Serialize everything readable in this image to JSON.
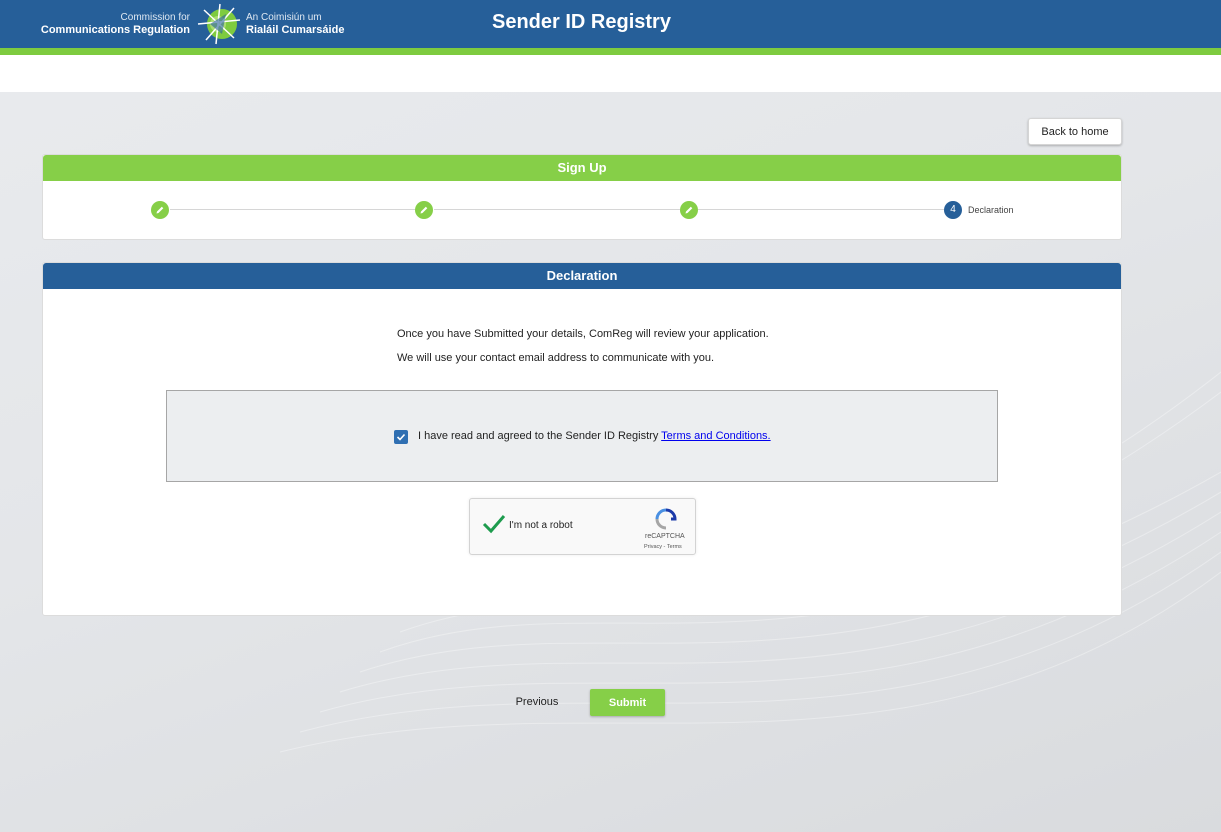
{
  "header": {
    "logo_en_line1": "Commission for",
    "logo_en_line2": "Communications Regulation",
    "logo_ga_line1": "An Coimisiún um",
    "logo_ga_line2": "Rialáil Cumarsáide",
    "title": "Sender ID Registry"
  },
  "nav": {
    "back_home_label": "Back to home"
  },
  "signup": {
    "title": "Sign Up",
    "steps": [
      {
        "state": "complete",
        "icon": "pencil-icon"
      },
      {
        "state": "complete",
        "icon": "pencil-icon"
      },
      {
        "state": "complete",
        "icon": "pencil-icon"
      },
      {
        "state": "current",
        "number": "4",
        "label": "Declaration"
      }
    ]
  },
  "declaration": {
    "title": "Declaration",
    "line1": "Once you have Submitted your details, ComReg will review your application.",
    "line2": "We will use your contact email address to communicate with you.",
    "agree_text": "I have read and agreed to the Sender ID Registry ",
    "terms_link": "Terms and Conditions.",
    "agreed": true
  },
  "captcha": {
    "label": "I'm not a robot",
    "brand": "reCAPTCHA",
    "links": "Privacy - Terms",
    "verified": true
  },
  "footer": {
    "previous_label": "Previous",
    "submit_label": "Submit"
  },
  "colors": {
    "header_blue": "#265f99",
    "accent_green": "#86cf48",
    "checkbox_blue": "#2f6fb2"
  }
}
